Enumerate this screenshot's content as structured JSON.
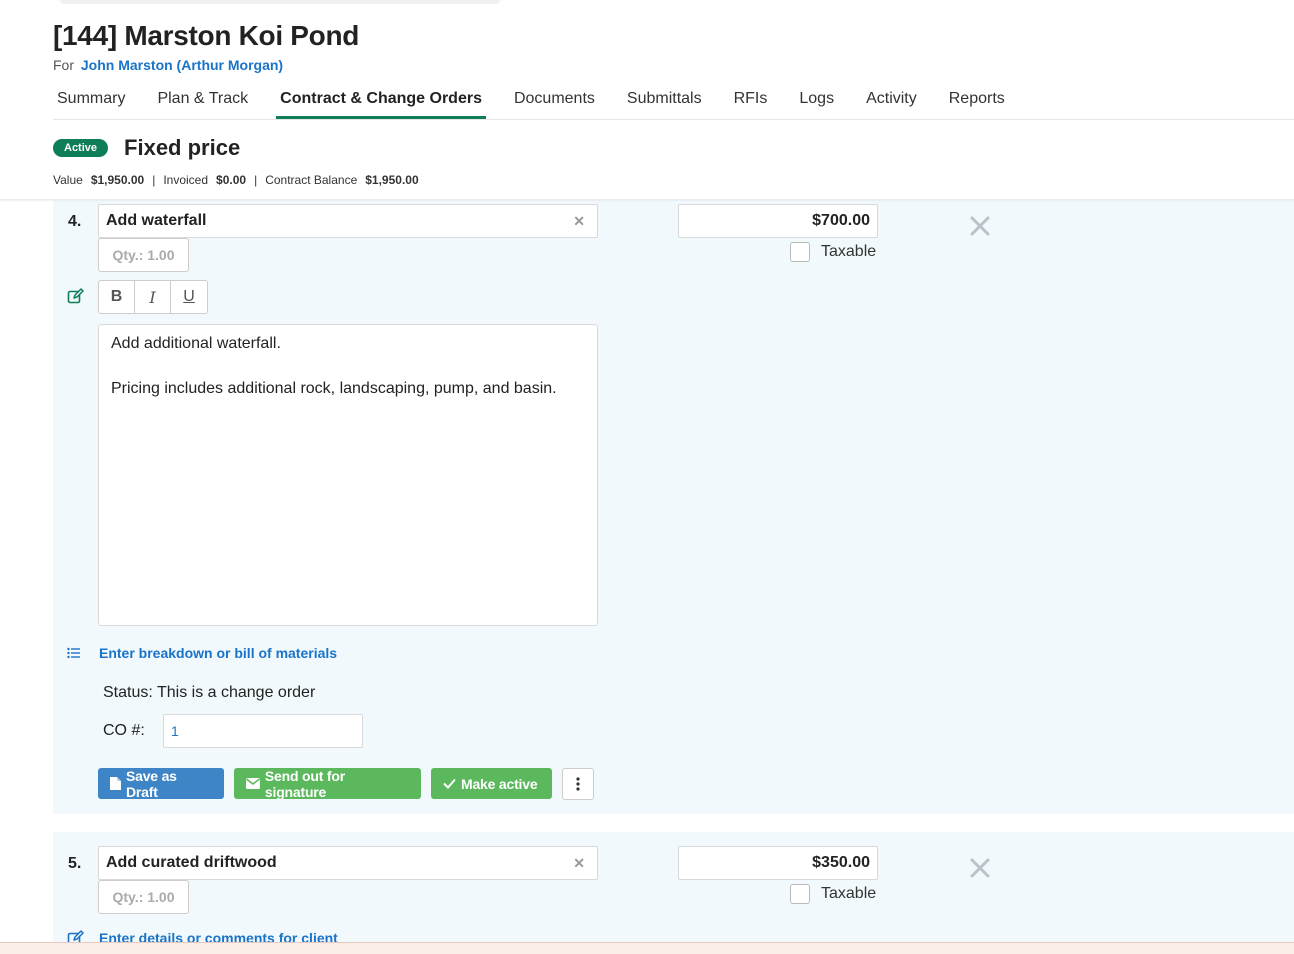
{
  "project": {
    "title": "[144] Marston Koi Pond",
    "for_prefix": "For",
    "client": "John Marston (Arthur Morgan)"
  },
  "tabs": [
    {
      "label": "Summary"
    },
    {
      "label": "Plan & Track"
    },
    {
      "label": "Contract & Change Orders",
      "active": true
    },
    {
      "label": "Documents"
    },
    {
      "label": "Submittals"
    },
    {
      "label": "RFIs"
    },
    {
      "label": "Logs"
    },
    {
      "label": "Activity"
    },
    {
      "label": "Reports"
    }
  ],
  "contract": {
    "status_badge": "Active",
    "type": "Fixed price",
    "value_label": "Value",
    "value": "$1,950.00",
    "invoiced_label": "Invoiced",
    "invoiced": "$0.00",
    "balance_label": "Contract Balance",
    "balance": "$1,950.00"
  },
  "items": [
    {
      "number": "4.",
      "name": "Add waterfall",
      "qty": "Qty.: 1.00",
      "price": "$700.00",
      "taxable_label": "Taxable",
      "description_line1": "Add additional waterfall.",
      "description_line2": "Pricing includes additional rock, landscaping, pump, and basin.",
      "bom_link": "Enter breakdown or bill of materials",
      "status_label": "Status:",
      "status_value": "This is a change order",
      "co_label": "CO #:",
      "co_value": "1",
      "buttons": {
        "save_draft": "Save as Draft",
        "send_signature": "Send out for signature",
        "make_active": "Make active"
      }
    },
    {
      "number": "5.",
      "name": "Add curated driftwood",
      "qty": "Qty.: 1.00",
      "price": "$350.00",
      "taxable_label": "Taxable",
      "details_link": "Enter details or comments for client"
    }
  ],
  "colors": {
    "accent_green": "#0e7d58",
    "link_blue": "#1a73c8",
    "button_blue": "#3d85c6",
    "button_green": "#5cb85c",
    "card_bg": "#f1f9fc"
  },
  "icons": {
    "toolbar": [
      "bold-icon",
      "italic-icon",
      "underline-icon"
    ],
    "edit": "edit-icon",
    "list": "list-icon",
    "remove": "close-icon",
    "more": "more-vertical-icon"
  },
  "toolbar_glyphs": {
    "bold": "B",
    "italic": "I",
    "underline": "U"
  }
}
